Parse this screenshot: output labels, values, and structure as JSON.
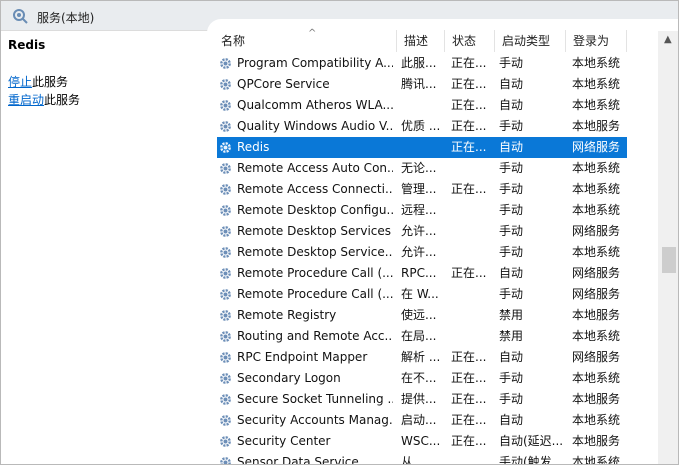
{
  "title": "服务(本地)",
  "left_pane": {
    "service_name": "Redis",
    "stop_link": "停止",
    "stop_suffix": "此服务",
    "restart_link": "重启动",
    "restart_suffix": "此服务"
  },
  "columns": [
    "名称",
    "描述",
    "状态",
    "启动类型",
    "登录为"
  ],
  "services": [
    {
      "name": "Program Compatibility A...",
      "desc": "此服...",
      "status": "正在...",
      "startup": "手动",
      "logon": "本地系统"
    },
    {
      "name": "QPCore Service",
      "desc": "腾讯...",
      "status": "正在...",
      "startup": "自动",
      "logon": "本地系统"
    },
    {
      "name": "Qualcomm Atheros WLA...",
      "desc": "",
      "status": "正在...",
      "startup": "自动",
      "logon": "本地系统"
    },
    {
      "name": "Quality Windows Audio V...",
      "desc": "优质 ...",
      "status": "正在...",
      "startup": "手动",
      "logon": "本地服务"
    },
    {
      "name": "Redis",
      "desc": "",
      "status": "正在...",
      "startup": "自动",
      "logon": "网络服务",
      "selected": true
    },
    {
      "name": "Remote Access Auto Con...",
      "desc": "无论...",
      "status": "",
      "startup": "手动",
      "logon": "本地系统"
    },
    {
      "name": "Remote Access Connecti...",
      "desc": "管理...",
      "status": "正在...",
      "startup": "手动",
      "logon": "本地系统"
    },
    {
      "name": "Remote Desktop Configu...",
      "desc": "远程...",
      "status": "",
      "startup": "手动",
      "logon": "本地系统"
    },
    {
      "name": "Remote Desktop Services",
      "desc": "允许...",
      "status": "",
      "startup": "手动",
      "logon": "网络服务"
    },
    {
      "name": "Remote Desktop Service...",
      "desc": "允许...",
      "status": "",
      "startup": "手动",
      "logon": "本地系统"
    },
    {
      "name": "Remote Procedure Call (...",
      "desc": "RPC...",
      "status": "正在...",
      "startup": "自动",
      "logon": "网络服务"
    },
    {
      "name": "Remote Procedure Call (...",
      "desc": "在 W...",
      "status": "",
      "startup": "手动",
      "logon": "网络服务"
    },
    {
      "name": "Remote Registry",
      "desc": "使远...",
      "status": "",
      "startup": "禁用",
      "logon": "本地服务"
    },
    {
      "name": "Routing and Remote Acc...",
      "desc": "在局...",
      "status": "",
      "startup": "禁用",
      "logon": "本地系统"
    },
    {
      "name": "RPC Endpoint Mapper",
      "desc": "解析 ...",
      "status": "正在...",
      "startup": "自动",
      "logon": "网络服务"
    },
    {
      "name": "Secondary Logon",
      "desc": "在不...",
      "status": "正在...",
      "startup": "手动",
      "logon": "本地系统"
    },
    {
      "name": "Secure Socket Tunneling ...",
      "desc": "提供...",
      "status": "正在...",
      "startup": "手动",
      "logon": "本地服务"
    },
    {
      "name": "Security Accounts Manag...",
      "desc": "启动...",
      "status": "正在...",
      "startup": "自动",
      "logon": "本地系统"
    },
    {
      "name": "Security Center",
      "desc": "WSC...",
      "status": "正在...",
      "startup": "自动(延迟...",
      "logon": "本地服务"
    },
    {
      "name": "Sensor Data Service",
      "desc": "从...",
      "status": "",
      "startup": "手动(触发...",
      "logon": "本地系统"
    }
  ],
  "scroll_position": 0.5,
  "colors": {
    "selection": "#0a78d7",
    "link": "#0066cc"
  }
}
